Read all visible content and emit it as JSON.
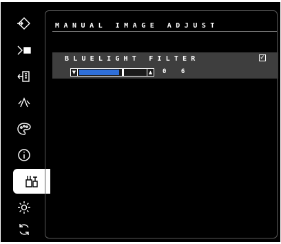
{
  "panel": {
    "title": "MANUAL IMAGE ADJUST",
    "setting": {
      "label": "BLUELIGHT FILTER",
      "checkbox": "☑",
      "value": "0 6",
      "level_fraction": 0.6,
      "dec_glyph": "▼",
      "inc_glyph": "▲"
    }
  },
  "rail": {
    "items": [
      {
        "icon": "input-select-icon"
      },
      {
        "icon": "audio-icon"
      },
      {
        "icon": "viewmode-icon"
      },
      {
        "icon": "color-adjust-icon"
      },
      {
        "icon": "color-palette-icon"
      },
      {
        "icon": "information-icon"
      },
      {
        "icon": "manual-image-adjust-icon"
      },
      {
        "icon": "setup-menu-icon"
      },
      {
        "icon": "memory-recall-icon"
      }
    ],
    "active_index": 6
  },
  "colors": {
    "background": "#000000",
    "row_highlight": "#3e3e3e",
    "slider_fill": "#2f6fd8"
  }
}
